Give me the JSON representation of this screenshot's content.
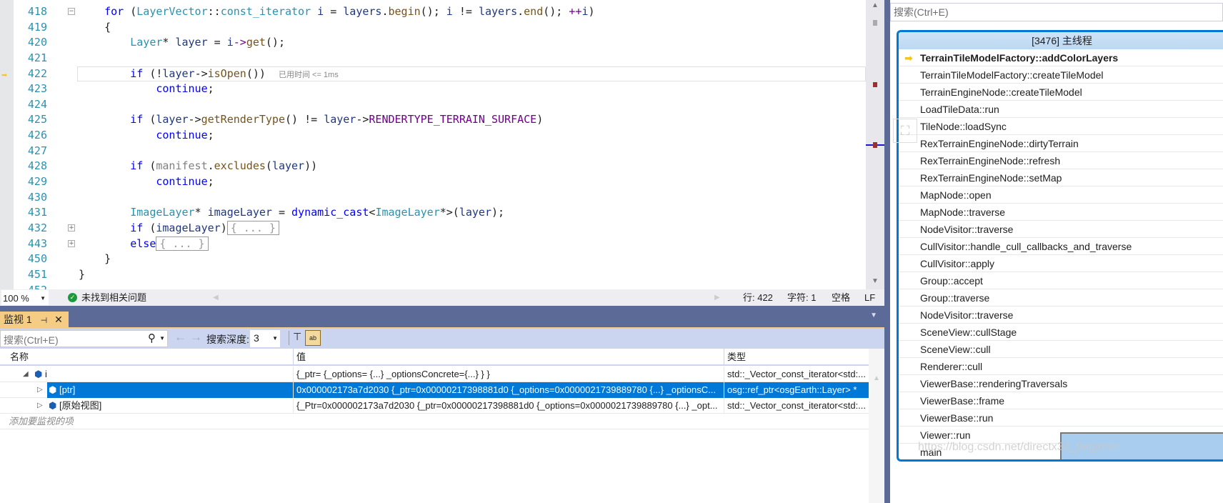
{
  "editor": {
    "lines": [
      {
        "n": "418",
        "fold": "-",
        "segs": [
          [
            "kw",
            "for "
          ],
          [
            "pl",
            "("
          ],
          [
            "ty",
            "LayerVector"
          ],
          [
            "pl",
            "::"
          ],
          [
            "ty",
            "const_iterator"
          ],
          [
            "pl",
            " "
          ],
          [
            "vr",
            "i"
          ],
          [
            "pl",
            " = "
          ],
          [
            "vr",
            "layers"
          ],
          [
            "pl",
            "."
          ],
          [
            "fn",
            "begin"
          ],
          [
            "pl",
            "(); "
          ],
          [
            "vr",
            "i"
          ],
          [
            "pl",
            " != "
          ],
          [
            "vr",
            "layers"
          ],
          [
            "pl",
            "."
          ],
          [
            "fn",
            "end"
          ],
          [
            "pl",
            "(); "
          ],
          [
            "mc",
            "++"
          ],
          [
            "vr",
            "i"
          ],
          [
            "pl",
            ")"
          ]
        ],
        "indent": 4
      },
      {
        "n": "419",
        "segs": [
          [
            "pl",
            "{"
          ]
        ],
        "indent": 4
      },
      {
        "n": "420",
        "segs": [
          [
            "ty",
            "Layer"
          ],
          [
            "pl",
            "* "
          ],
          [
            "vr",
            "layer"
          ],
          [
            "pl",
            " = "
          ],
          [
            "vr",
            "i"
          ],
          [
            "mc",
            "->"
          ],
          [
            "fn",
            "get"
          ],
          [
            "pl",
            "();"
          ]
        ],
        "indent": 8
      },
      {
        "n": "421",
        "segs": [],
        "indent": 8
      },
      {
        "n": "422",
        "current": true,
        "segs": [
          [
            "kw",
            "if "
          ],
          [
            "pl",
            "(!"
          ],
          [
            "vr",
            "layer"
          ],
          [
            "pl",
            "->"
          ],
          [
            "fn",
            "isOpen"
          ],
          [
            "pl",
            "())"
          ]
        ],
        "hint": "已用时间 <= 1ms",
        "indent": 8
      },
      {
        "n": "423",
        "segs": [
          [
            "kw",
            "continue"
          ],
          [
            "pl",
            ";"
          ]
        ],
        "indent": 12
      },
      {
        "n": "424",
        "segs": [],
        "indent": 8
      },
      {
        "n": "425",
        "segs": [
          [
            "kw",
            "if "
          ],
          [
            "pl",
            "("
          ],
          [
            "vr",
            "layer"
          ],
          [
            "pl",
            "->"
          ],
          [
            "fn",
            "getRenderType"
          ],
          [
            "pl",
            "() != "
          ],
          [
            "vr",
            "layer"
          ],
          [
            "pl",
            "->"
          ],
          [
            "mc",
            "RENDERTYPE_TERRAIN_SURFACE"
          ],
          [
            "pl",
            ")"
          ]
        ],
        "indent": 8
      },
      {
        "n": "426",
        "segs": [
          [
            "kw",
            "continue"
          ],
          [
            "pl",
            ";"
          ]
        ],
        "indent": 12
      },
      {
        "n": "427",
        "segs": [],
        "indent": 8
      },
      {
        "n": "428",
        "segs": [
          [
            "kw",
            "if "
          ],
          [
            "pl",
            "("
          ],
          [
            "pm",
            "manifest"
          ],
          [
            "pl",
            "."
          ],
          [
            "fn",
            "excludes"
          ],
          [
            "pl",
            "("
          ],
          [
            "vr",
            "layer"
          ],
          [
            "pl",
            "))"
          ]
        ],
        "indent": 8
      },
      {
        "n": "429",
        "segs": [
          [
            "kw",
            "continue"
          ],
          [
            "pl",
            ";"
          ]
        ],
        "indent": 12
      },
      {
        "n": "430",
        "segs": [],
        "indent": 8
      },
      {
        "n": "431",
        "segs": [
          [
            "ty",
            "ImageLayer"
          ],
          [
            "pl",
            "* "
          ],
          [
            "vr",
            "imageLayer"
          ],
          [
            "pl",
            " = "
          ],
          [
            "kw",
            "dynamic_cast"
          ],
          [
            "pl",
            "<"
          ],
          [
            "ty",
            "ImageLayer"
          ],
          [
            "pl",
            "*>("
          ],
          [
            "vr",
            "layer"
          ],
          [
            "pl",
            ");"
          ]
        ],
        "indent": 8
      },
      {
        "n": "432",
        "fold": "+",
        "segs": [
          [
            "kw",
            "if "
          ],
          [
            "pl",
            "("
          ],
          [
            "vr",
            "imageLayer"
          ],
          [
            "pl",
            ")"
          ]
        ],
        "collapsed": "{ ... }",
        "indent": 8
      },
      {
        "n": "443",
        "fold": "+",
        "segs": [
          [
            "kw",
            "else"
          ]
        ],
        "collapsed": "{ ... }",
        "indent": 8
      },
      {
        "n": "450",
        "segs": [
          [
            "pl",
            "}"
          ]
        ],
        "indent": 4
      },
      {
        "n": "451",
        "segs": [
          [
            "pl",
            "}"
          ]
        ],
        "indent": 0
      },
      {
        "n": "452",
        "segs": [],
        "indent": 0
      }
    ]
  },
  "status": {
    "zoom": "100 %",
    "issues": "未找到相关问题",
    "line": "行: 422",
    "char": "字符: 1",
    "spaces": "空格",
    "eol": "LF"
  },
  "watch": {
    "tab": "监视 1",
    "search_placeholder": "搜索(Ctrl+E)",
    "depth_label": "搜索深度:",
    "depth": "3",
    "columns": [
      "名称",
      "值",
      "类型"
    ],
    "rows": [
      {
        "name": "i",
        "expand": "◢",
        "value": "{_ptr= {_options= {...} _optionsConcrete={...} } }",
        "type": "std::_Vector_const_iterator<std:...",
        "indent": 0
      },
      {
        "name": "[ptr]",
        "expand": "▷",
        "value": "0x000002173a7d2030 {_ptr=0x00000217398881d0 {_options=0x0000021739889780 {...} _optionsC...",
        "type": "osg::ref_ptr<osgEarth::Layer> *",
        "selected": true,
        "indent": 1
      },
      {
        "name": "[原始视图]",
        "expand": "▷",
        "value": "{_Ptr=0x000002173a7d2030 {_ptr=0x00000217398881d0 {_options=0x0000021739889780 {...} _opt...",
        "type": "std::_Vector_const_iterator<std:...",
        "indent": 1
      }
    ],
    "add_item": "添加要监视的项"
  },
  "callstack": {
    "search_placeholder": "搜索(Ctrl+E)",
    "title": "[3476] 主线程",
    "frames": [
      "TerrainTileModelFactory::addColorLayers",
      "TerrainTileModelFactory::createTileModel",
      "TerrainEngineNode::createTileModel",
      "LoadTileData::run",
      "TileNode::loadSync",
      "RexTerrainEngineNode::dirtyTerrain",
      "RexTerrainEngineNode::refresh",
      "RexTerrainEngineNode::setMap",
      "MapNode::open",
      "MapNode::traverse",
      "NodeVisitor::traverse",
      "CullVisitor::handle_cull_callbacks_and_traverse",
      "CullVisitor::apply",
      "Group::accept",
      "Group::traverse",
      "NodeVisitor::traverse",
      "SceneView::cullStage",
      "SceneView::cull",
      "Renderer::cull",
      "ViewerBase::renderingTraversals",
      "ViewerBase::frame",
      "ViewerBase::run",
      "Viewer::run",
      "main"
    ]
  },
  "watermark": "https://blog.csdn.net/directx3d_beginner",
  "colors": {
    "accent": "#0078d7",
    "panel": "#5c6a97",
    "tab": "#f5cc84",
    "toolbar": "#ccd5f0"
  }
}
